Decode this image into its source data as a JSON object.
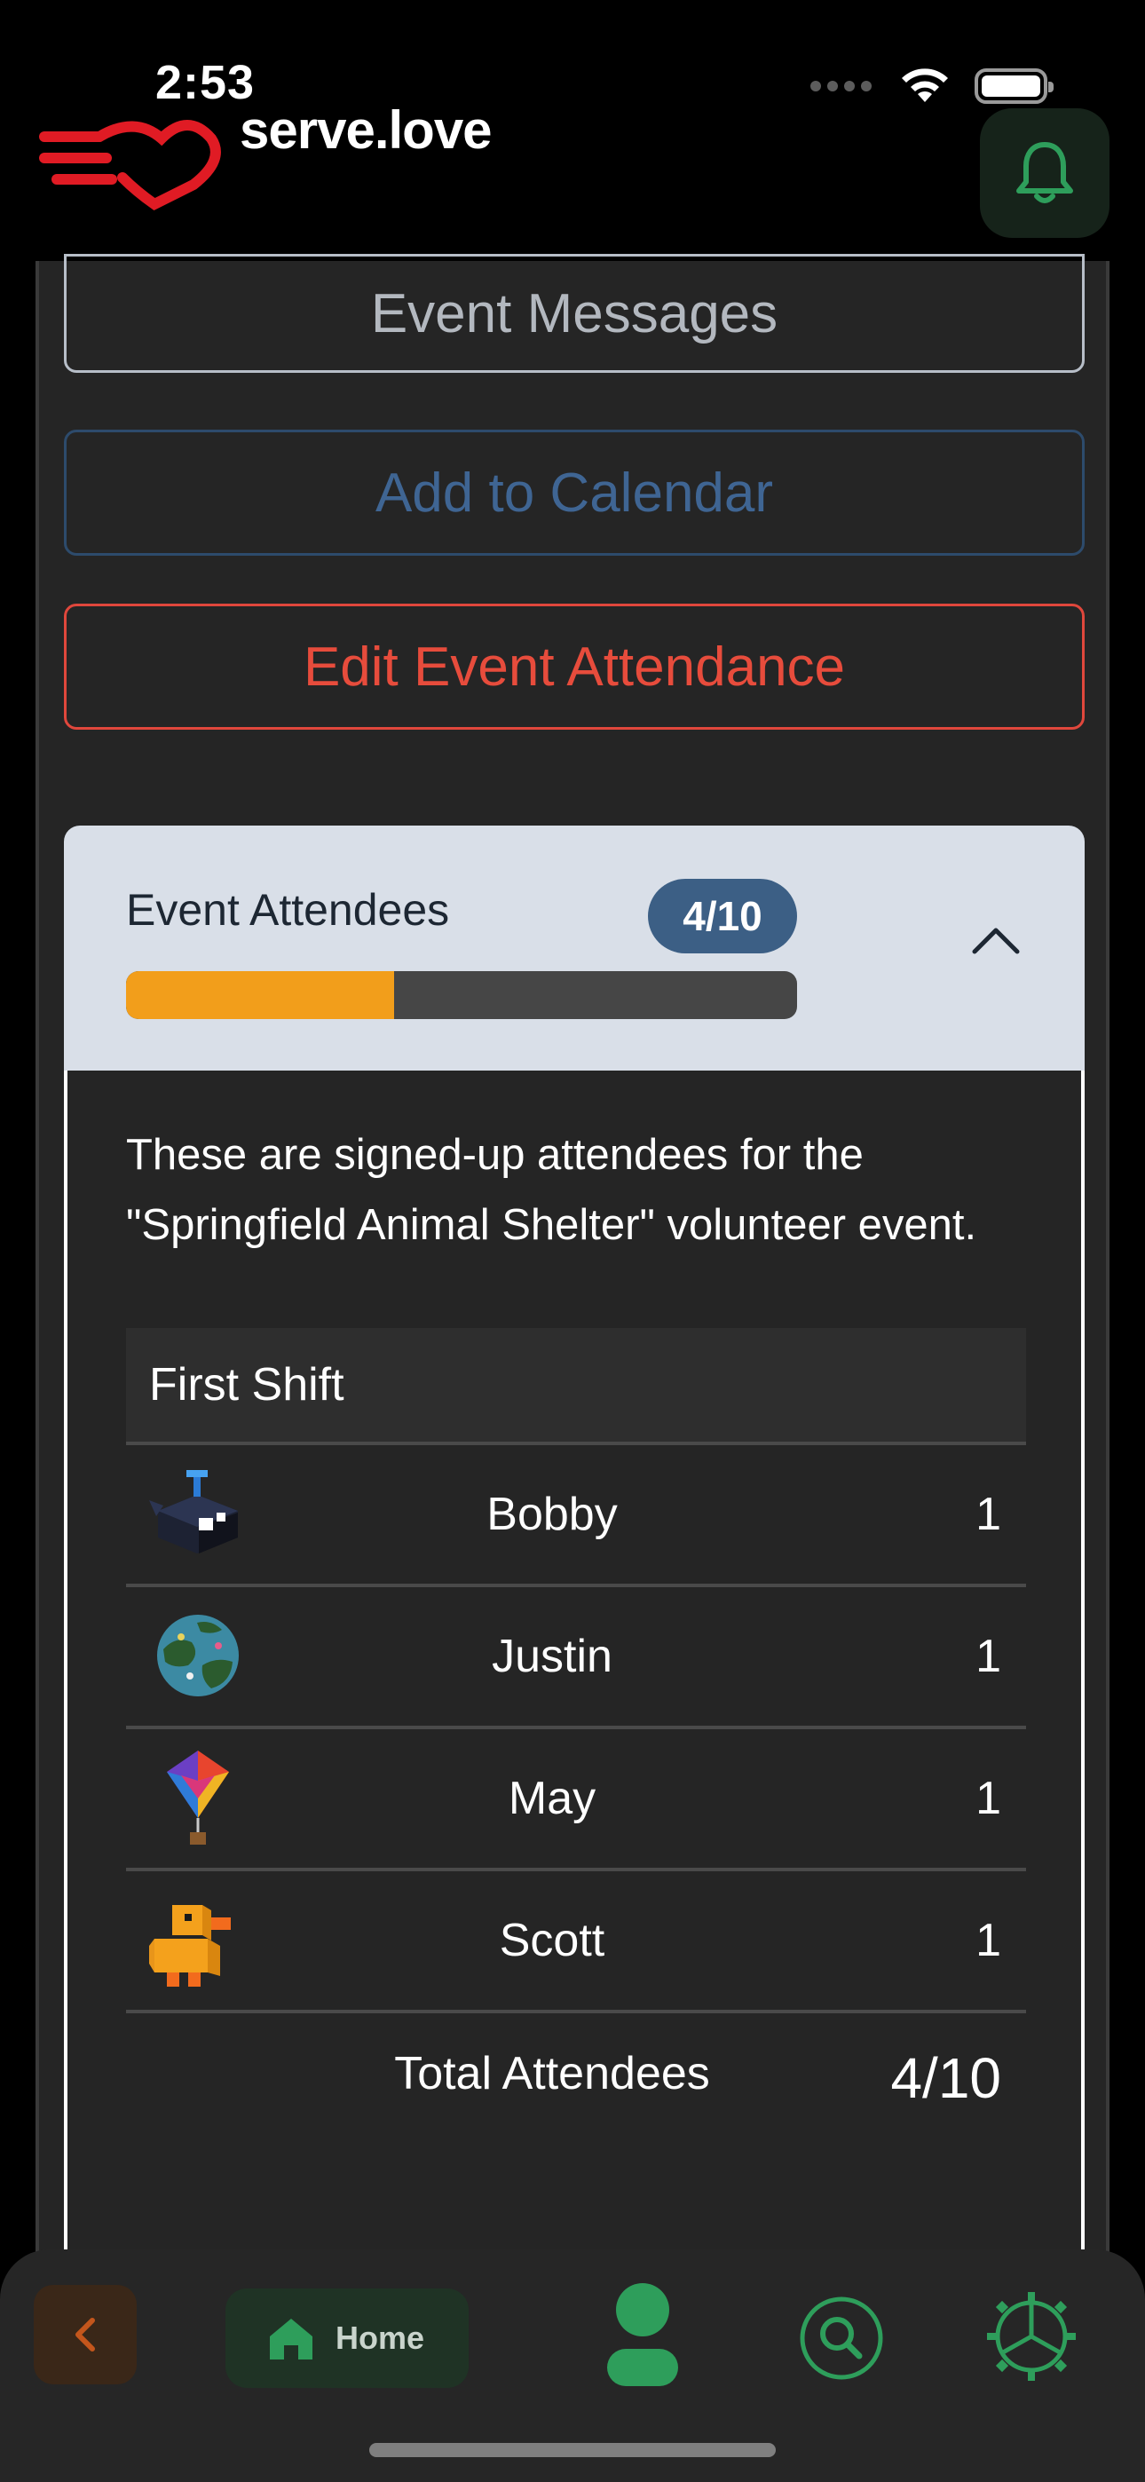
{
  "status_bar": {
    "time": "2:53"
  },
  "header": {
    "brand": "serve.love"
  },
  "buttons": {
    "event_messages": "Event Messages",
    "add_to_calendar": "Add to Calendar",
    "edit_attendance": "Edit Event Attendance"
  },
  "attendees_card": {
    "title": "Event Attendees",
    "count_badge": "4/10",
    "progress_fraction": 0.4,
    "description": "These are signed-up attendees for the \"Springfield Animal Shelter\" volunteer event.",
    "shift": {
      "name": "First Shift",
      "rows": [
        {
          "name": "Bobby",
          "count": "1",
          "avatar": "whale-avatar"
        },
        {
          "name": "Justin",
          "count": "1",
          "avatar": "planet-avatar"
        },
        {
          "name": "May",
          "count": "1",
          "avatar": "kite-avatar"
        },
        {
          "name": "Scott",
          "count": "1",
          "avatar": "duck-avatar"
        }
      ],
      "total_label": "Total Attendees",
      "total_value": "4/10"
    }
  },
  "tab_bar": {
    "home_label": "Home"
  },
  "colors": {
    "accent_green": "#2e9e5b",
    "danger_red": "#e74c3c",
    "calendar_blue": "#3f6593",
    "progress_orange": "#f29e1b",
    "badge_blue": "#3c5f85"
  }
}
